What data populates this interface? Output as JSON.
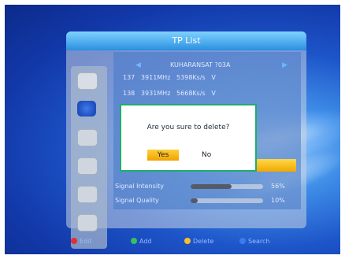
{
  "title": "TP List",
  "satellite": "KUHARANSAT ?03A",
  "tp_rows": [
    {
      "index": "137",
      "freq": "3911MHz",
      "symbol": "5398Ks/s",
      "pol": "V"
    },
    {
      "index": "138",
      "freq": "3931MHz",
      "symbol": "5668Ks/s",
      "pol": "V"
    }
  ],
  "signal": {
    "intensity_label": "Signal Intensity",
    "intensity_value": "56%",
    "intensity_level": 0.56,
    "quality_label": "Signal Quality",
    "quality_value": "10%",
    "quality_level": 0.1
  },
  "dialog": {
    "question": "Are you sure to delete?",
    "yes_label": "Yes",
    "no_label": "No"
  },
  "footer": [
    {
      "label": "Edit",
      "color": "#e03030"
    },
    {
      "label": "Add",
      "color": "#35c35a"
    },
    {
      "label": "Delete",
      "color": "#f3c12c"
    },
    {
      "label": "Search",
      "color": "#3a7cf0"
    }
  ],
  "sidebar_icons": [
    "dish-icon",
    "globe-icon",
    "satellite-icon",
    "antenna-icon",
    "tools-icon",
    "settings-icon"
  ]
}
